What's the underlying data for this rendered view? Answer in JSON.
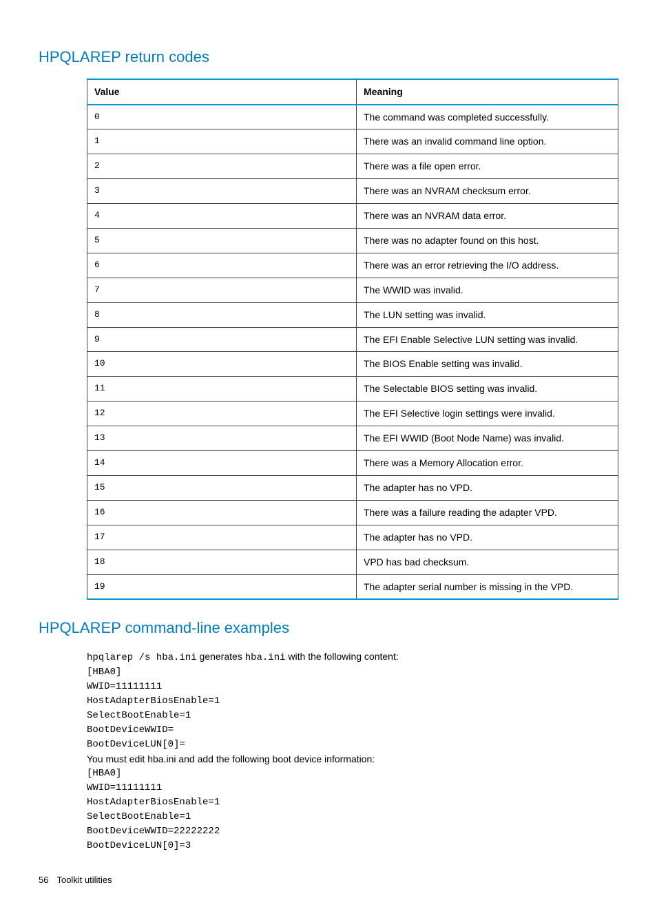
{
  "section1": {
    "heading": "HPQLAREP return codes"
  },
  "table": {
    "col_value": "Value",
    "col_meaning": "Meaning",
    "rows": [
      {
        "v": "0",
        "m": "The command was completed successfully."
      },
      {
        "v": "1",
        "m": "There was an invalid command line option."
      },
      {
        "v": "2",
        "m": "There was a file open error."
      },
      {
        "v": "3",
        "m": "There was an NVRAM checksum error."
      },
      {
        "v": "4",
        "m": "There was an NVRAM data error."
      },
      {
        "v": "5",
        "m": "There was no adapter found on this host."
      },
      {
        "v": "6",
        "m": "There was an error retrieving the I/O address."
      },
      {
        "v": "7",
        "m": "The WWID was invalid."
      },
      {
        "v": "8",
        "m": "The LUN setting was invalid."
      },
      {
        "v": "9",
        "m": "The EFI Enable Selective LUN setting was invalid."
      },
      {
        "v": "10",
        "m": "The BIOS Enable setting was invalid."
      },
      {
        "v": "11",
        "m": "The Selectable BIOS setting was invalid."
      },
      {
        "v": "12",
        "m": "The EFI Selective login settings were invalid."
      },
      {
        "v": "13",
        "m": "The EFI WWID (Boot Node Name) was invalid."
      },
      {
        "v": "14",
        "m": "There was a Memory Allocation error."
      },
      {
        "v": "15",
        "m": "The adapter has no VPD."
      },
      {
        "v": "16",
        "m": "There was a failure reading the adapter VPD."
      },
      {
        "v": "17",
        "m": "The adapter has no VPD."
      },
      {
        "v": "18",
        "m": "VPD has bad checksum."
      },
      {
        "v": "19",
        "m": "The adapter serial number is missing in the VPD."
      }
    ]
  },
  "section2": {
    "heading": "HPQLAREP command-line examples"
  },
  "example": {
    "line1_cmd": "hpqlarep /s hba.ini",
    "line1_mid": " generates ",
    "line1_file": "hba.ini",
    "line1_rest": " with the following content:",
    "block1": [
      "[HBA0]",
      "WWID=11111111",
      "HostAdapterBiosEnable=1",
      "SelectBootEnable=1",
      "BootDeviceWWID=",
      "BootDeviceLUN[0]="
    ],
    "line2": "You must edit hba.ini and add the following boot device information:",
    "block2": [
      "[HBA0]",
      "WWID=11111111",
      "HostAdapterBiosEnable=1",
      "SelectBootEnable=1",
      "BootDeviceWWID=22222222",
      "BootDeviceLUN[0]=3"
    ]
  },
  "footer": {
    "page": "56",
    "section": "Toolkit utilities"
  }
}
